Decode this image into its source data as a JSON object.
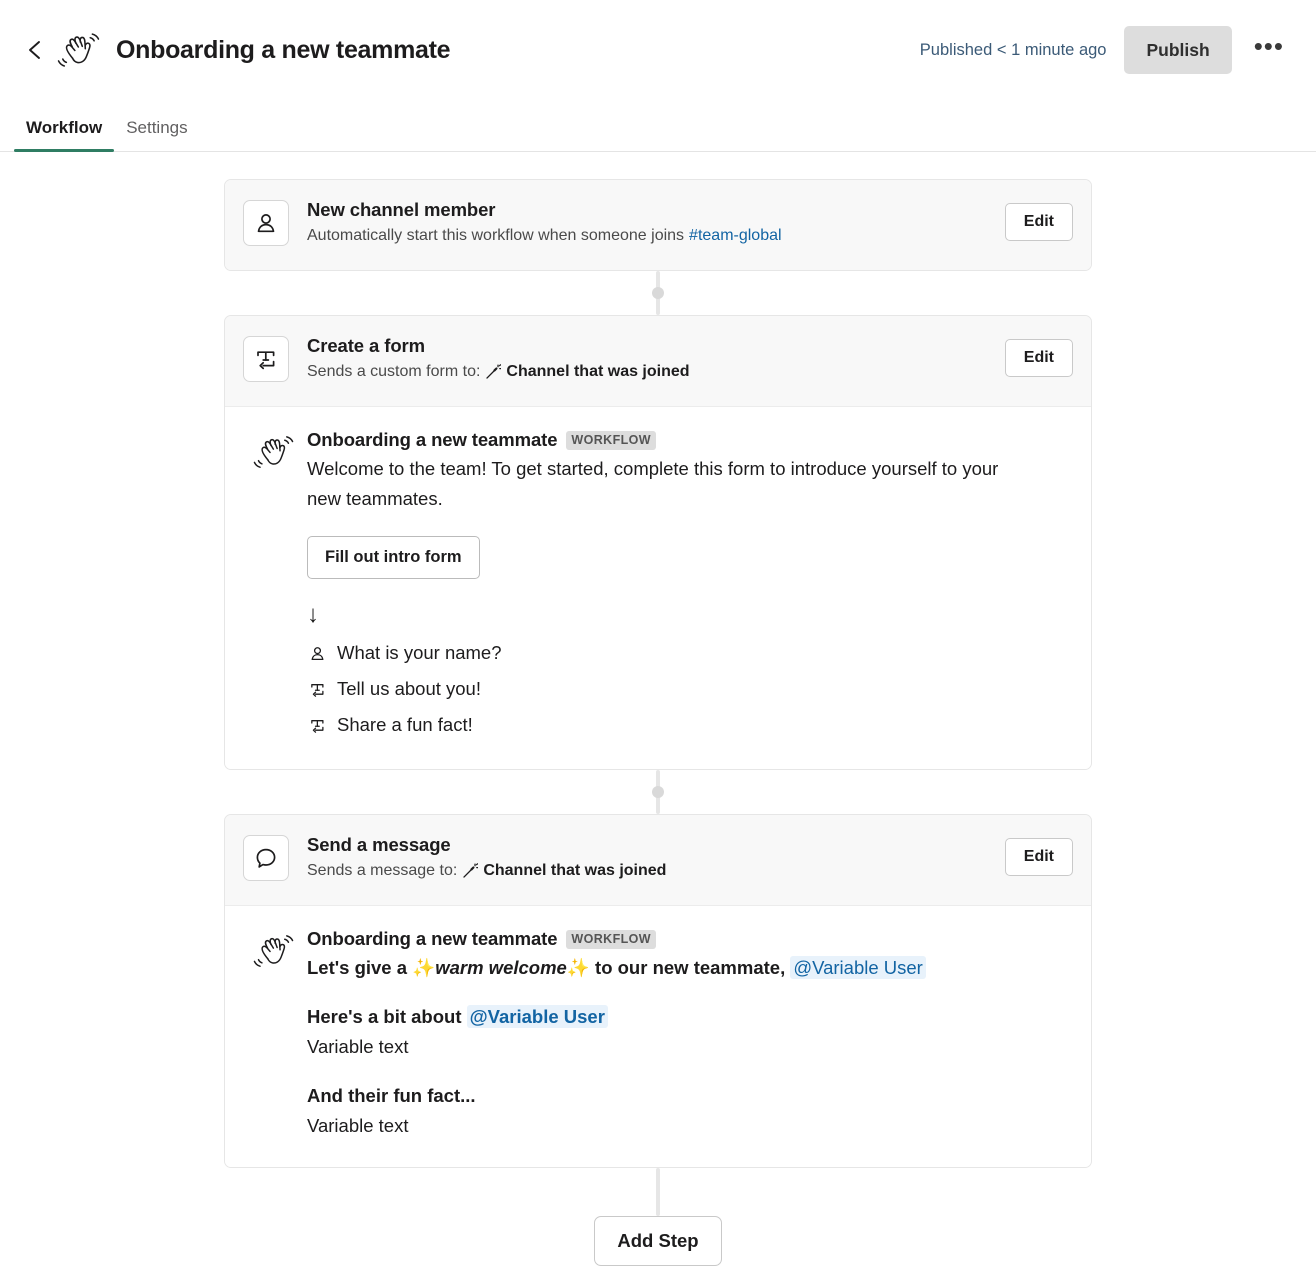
{
  "header": {
    "back_icon": "chevron-left-icon",
    "workflow_emoji": "waving-hand-emoji",
    "title": "Onboarding a new teammate",
    "published_status": "Published < 1 minute ago",
    "publish_label": "Publish",
    "more_label": "•••"
  },
  "tabs": [
    {
      "label": "Workflow",
      "active": true
    },
    {
      "label": "Settings",
      "active": false
    }
  ],
  "steps": [
    {
      "icon": "person-icon",
      "title": "New channel member",
      "subtitle_prefix": "Automatically start this workflow when someone joins",
      "channel": "#team-global",
      "edit_label": "Edit"
    },
    {
      "icon": "form-text-icon",
      "title": "Create a form",
      "subtitle_prefix": "Sends a custom form to:",
      "variable": "Channel that was joined",
      "edit_label": "Edit",
      "preview": {
        "emoji": "waving-hand-emoji",
        "author": "Onboarding a new teammate",
        "badge": "WORKFLOW",
        "text": "Welcome to the team! To get started, complete this form to introduce yourself to your new teammates.",
        "button_label": "Fill out intro form",
        "arrow": "↓",
        "fields": [
          {
            "icon": "person-icon",
            "label": "What is your name?"
          },
          {
            "icon": "text-field-icon",
            "label": "Tell us about you!"
          },
          {
            "icon": "text-field-icon",
            "label": "Share a fun fact!"
          }
        ]
      }
    },
    {
      "icon": "speech-bubble-icon",
      "title": "Send a message",
      "subtitle_prefix": "Sends a message to:",
      "variable": "Channel that was joined",
      "edit_label": "Edit",
      "preview": {
        "emoji": "waving-hand-emoji",
        "author": "Onboarding a new teammate",
        "badge": "WORKFLOW",
        "line_part1": "Let's give a ",
        "sparkle": "✨",
        "line_italic": "warm welcome",
        "line_part2": " to our new teammate, ",
        "mention1": "@Variable User",
        "block1_title_prefix": "Here's a bit about ",
        "block1_mention": "@Variable User",
        "block1_value": "Variable text",
        "block2_title": "And their fun fact...",
        "block2_value": "Variable text"
      }
    }
  ],
  "footer": {
    "add_step_label": "Add Step"
  },
  "colors": {
    "accent_green": "#2f7d63",
    "link_blue": "#1264a3",
    "status_blue": "#3b5a77",
    "mention_bg": "#e8f2fb",
    "card_bg": "#f8f8f8"
  }
}
